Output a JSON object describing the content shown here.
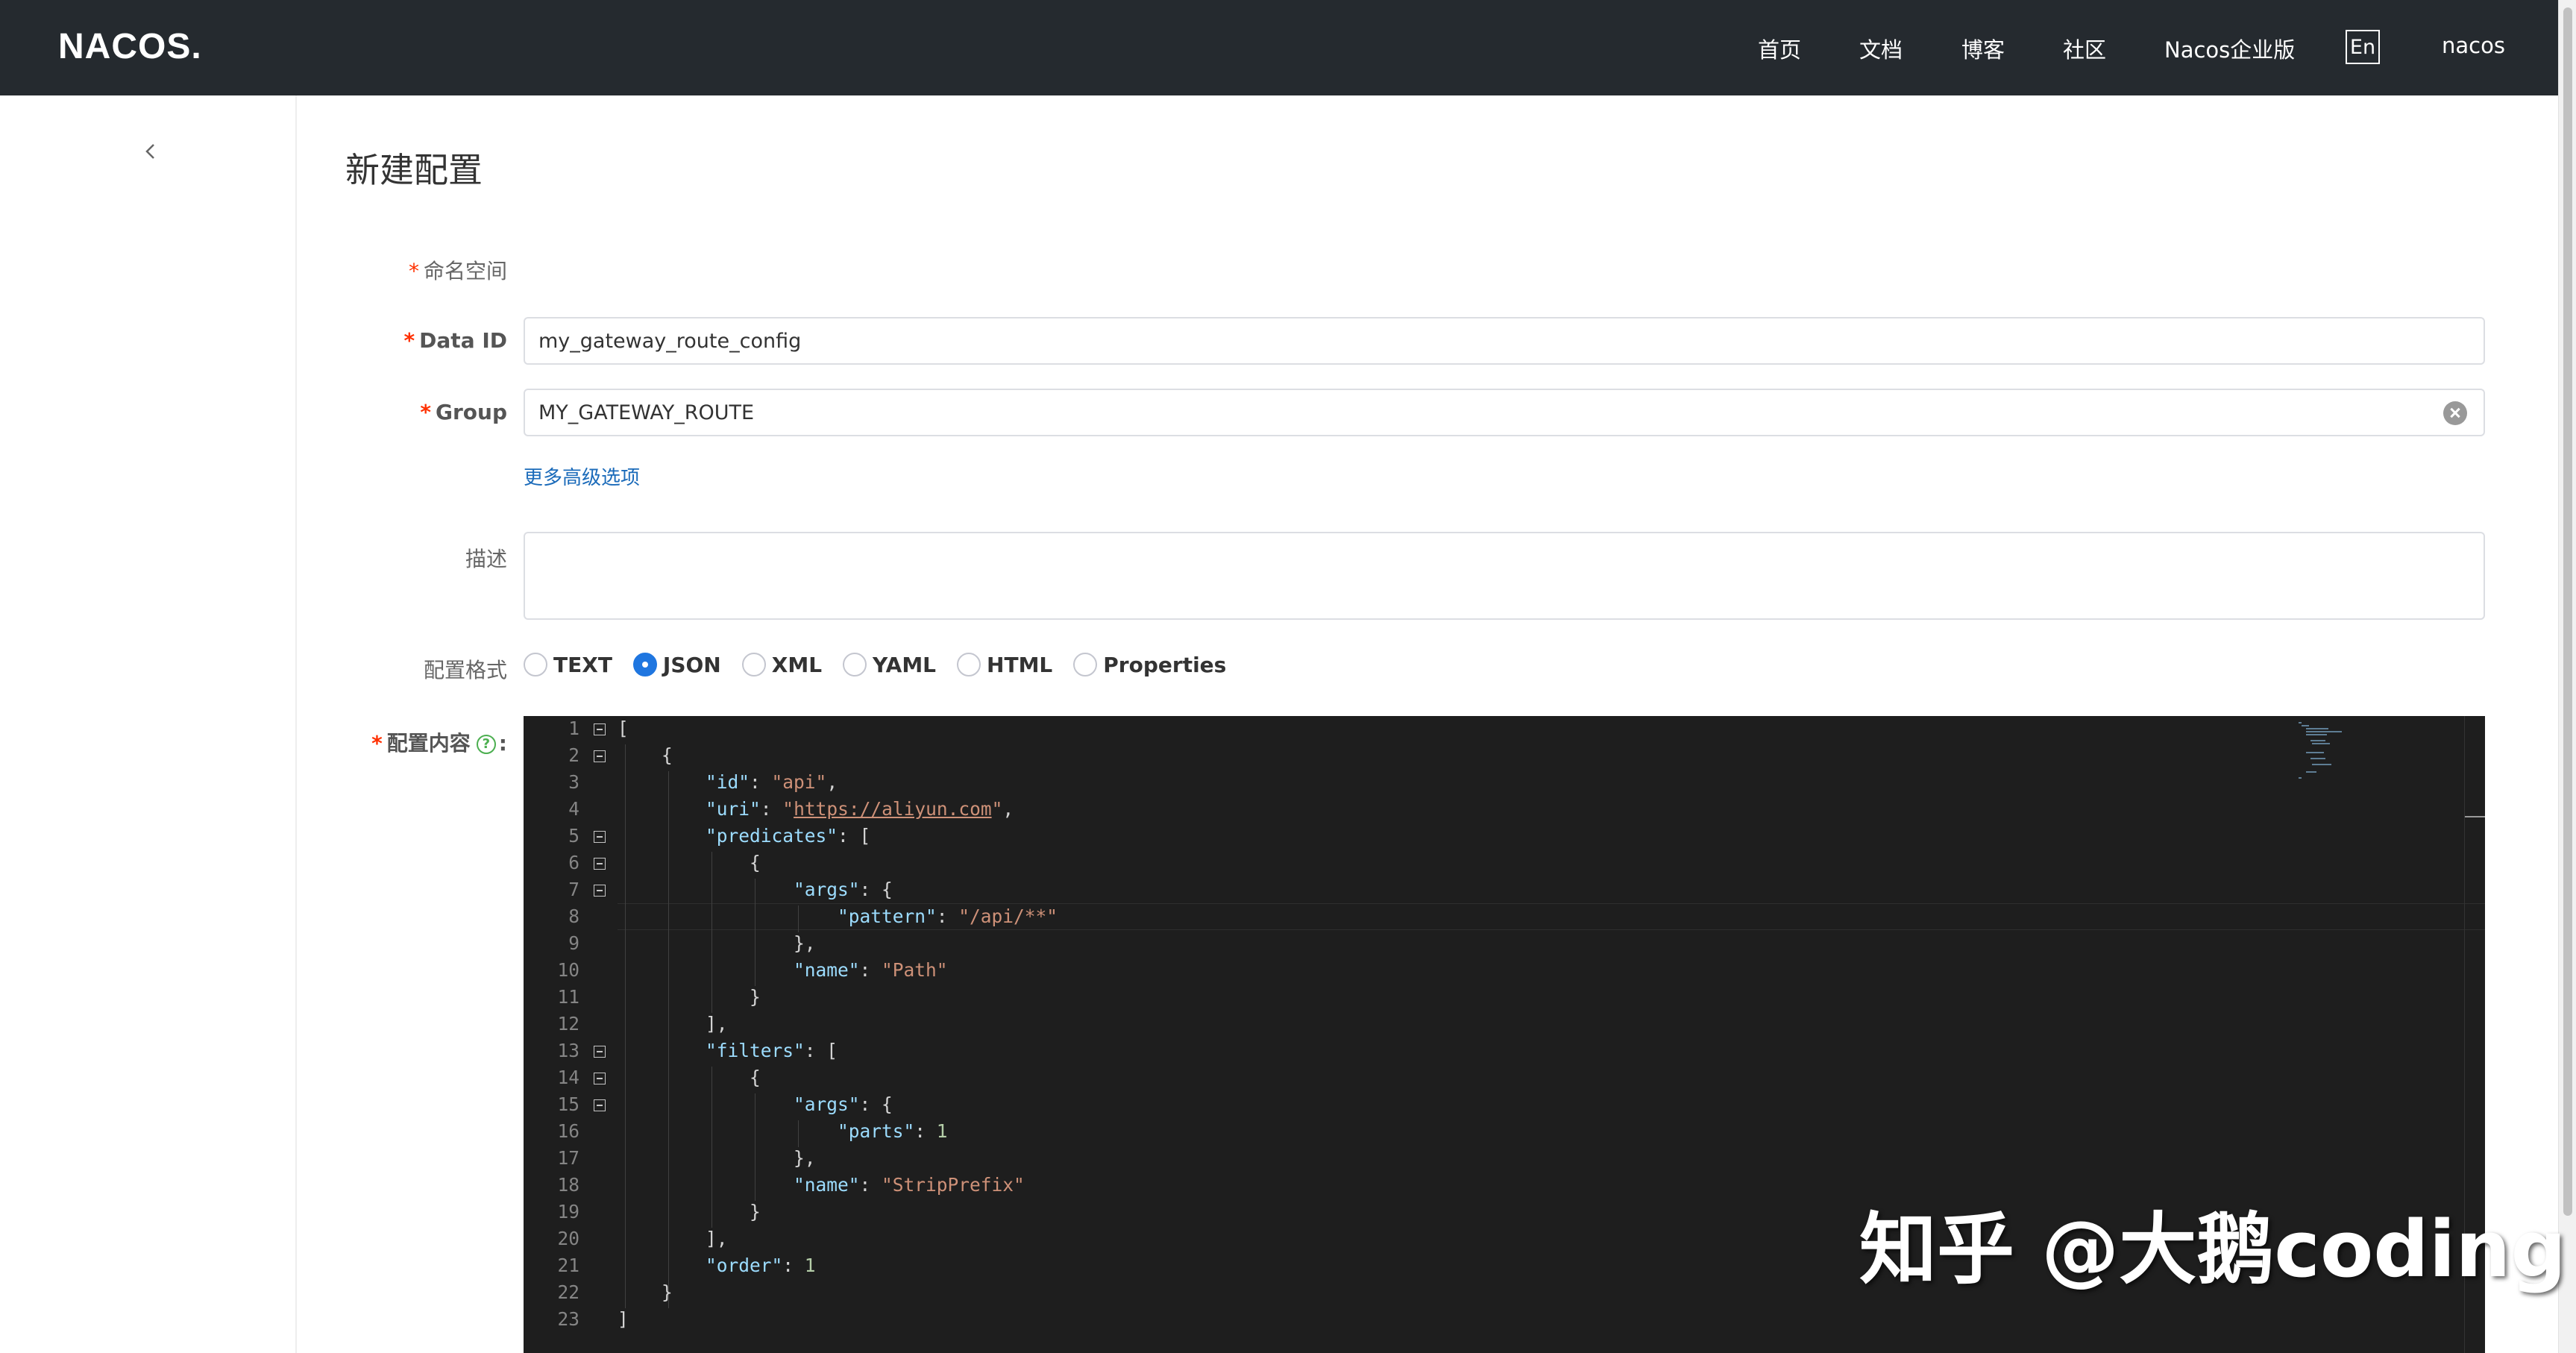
{
  "header": {
    "logo_text": "NACOS",
    "nav": [
      "首页",
      "文档",
      "博客",
      "社区",
      "Nacos企业版"
    ],
    "lang": "En",
    "user": "nacos"
  },
  "page": {
    "title": "新建配置"
  },
  "form": {
    "namespace_label": "命名空间",
    "dataid_label": "Data ID",
    "dataid_value": "my_gateway_route_config",
    "group_label": "Group",
    "group_value": "MY_GATEWAY_ROUTE",
    "advanced_link": "更多高级选项",
    "desc_label": "描述",
    "desc_value": "",
    "format_label": "配置格式",
    "formats": [
      "TEXT",
      "JSON",
      "XML",
      "YAML",
      "HTML",
      "Properties"
    ],
    "selected_format": "JSON",
    "content_label": "配置内容",
    "content_colon": ":",
    "help_glyph": "?"
  },
  "editor": {
    "line_numbers": [
      "1",
      "2",
      "3",
      "4",
      "5",
      "6",
      "7",
      "8",
      "9",
      "10",
      "11",
      "12",
      "13",
      "14",
      "15",
      "16",
      "17",
      "18",
      "19",
      "20",
      "21",
      "22",
      "23"
    ],
    "code": {
      "l1": "[",
      "l2": "    {",
      "l3_key": "\"id\"",
      "l3_val": "\"api\"",
      "l4_key": "\"uri\"",
      "l4_val_open": "\"",
      "l4_url": "https://aliyun.com",
      "l4_val_close": "\"",
      "l5_key": "\"predicates\"",
      "l6": "{",
      "l7_key": "\"args\"",
      "l8_key": "\"pattern\"",
      "l8_val": "\"/api/**\"",
      "l9": "},",
      "l10_key": "\"name\"",
      "l10_val": "\"Path\"",
      "l11": "}",
      "l12": "],",
      "l13_key": "\"filters\"",
      "l14": "{",
      "l15_key": "\"args\"",
      "l16_key": "\"parts\"",
      "l16_val": "1",
      "l17": "},",
      "l18_key": "\"name\"",
      "l18_val": "\"StripPrefix\"",
      "l19": "}",
      "l20": "],",
      "l21_key": "\"order\"",
      "l21_val": "1",
      "l22": "}",
      "l23": "]"
    }
  },
  "watermark": "知乎 @大鹅coding"
}
